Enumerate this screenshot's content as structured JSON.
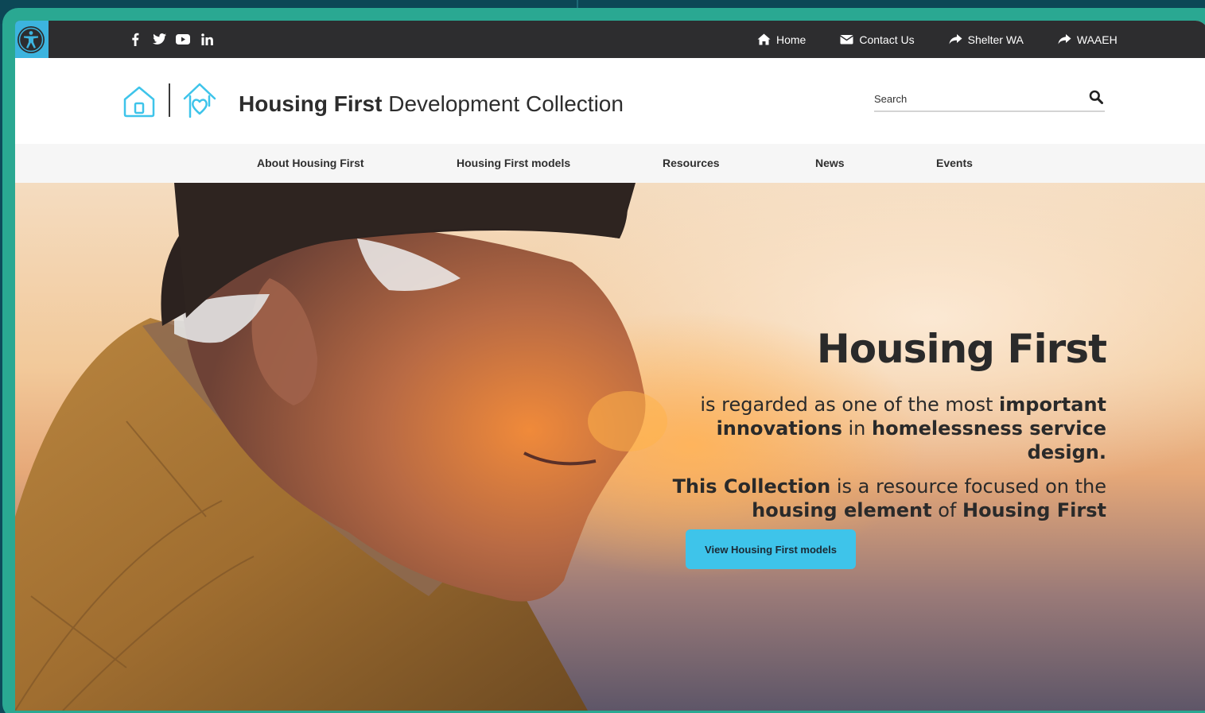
{
  "colors": {
    "topbar": "#2d2d2f",
    "accent": "#3ec4ea",
    "frame": "#2aa892",
    "background": "#0d4a5a",
    "nav_bg": "#f6f6f6"
  },
  "topbar": {
    "accessibility_icon": "accessibility-icon",
    "social": [
      {
        "name": "facebook-icon",
        "glyph": "f"
      },
      {
        "name": "twitter-icon",
        "glyph": "t"
      },
      {
        "name": "youtube-icon",
        "glyph": "yt"
      },
      {
        "name": "linkedin-icon",
        "glyph": "in"
      }
    ],
    "links": [
      {
        "label": "Home",
        "icon": "home-icon"
      },
      {
        "label": "Contact Us",
        "icon": "envelope-icon"
      },
      {
        "label": "Shelter WA",
        "icon": "share-arrow-icon"
      },
      {
        "label": "WAAEH",
        "icon": "share-arrow-icon"
      }
    ]
  },
  "header": {
    "title_bold": "Housing First",
    "title_rest": " Development Collection",
    "search_placeholder": "Search"
  },
  "nav": {
    "items": [
      "About Housing First",
      "Housing First models",
      "Resources",
      "News",
      "Events"
    ]
  },
  "hero": {
    "title": "Housing First",
    "p1": {
      "a": "is regarded as one of the most ",
      "b": "important innovations",
      "c": " in ",
      "d": "homelessness service design",
      "e": "."
    },
    "p2": {
      "a": "This Collection",
      "b": " is a resource focused on the ",
      "c": "housing element",
      "d": " of ",
      "e": "Housing First"
    },
    "button_label": "View Housing First models"
  }
}
